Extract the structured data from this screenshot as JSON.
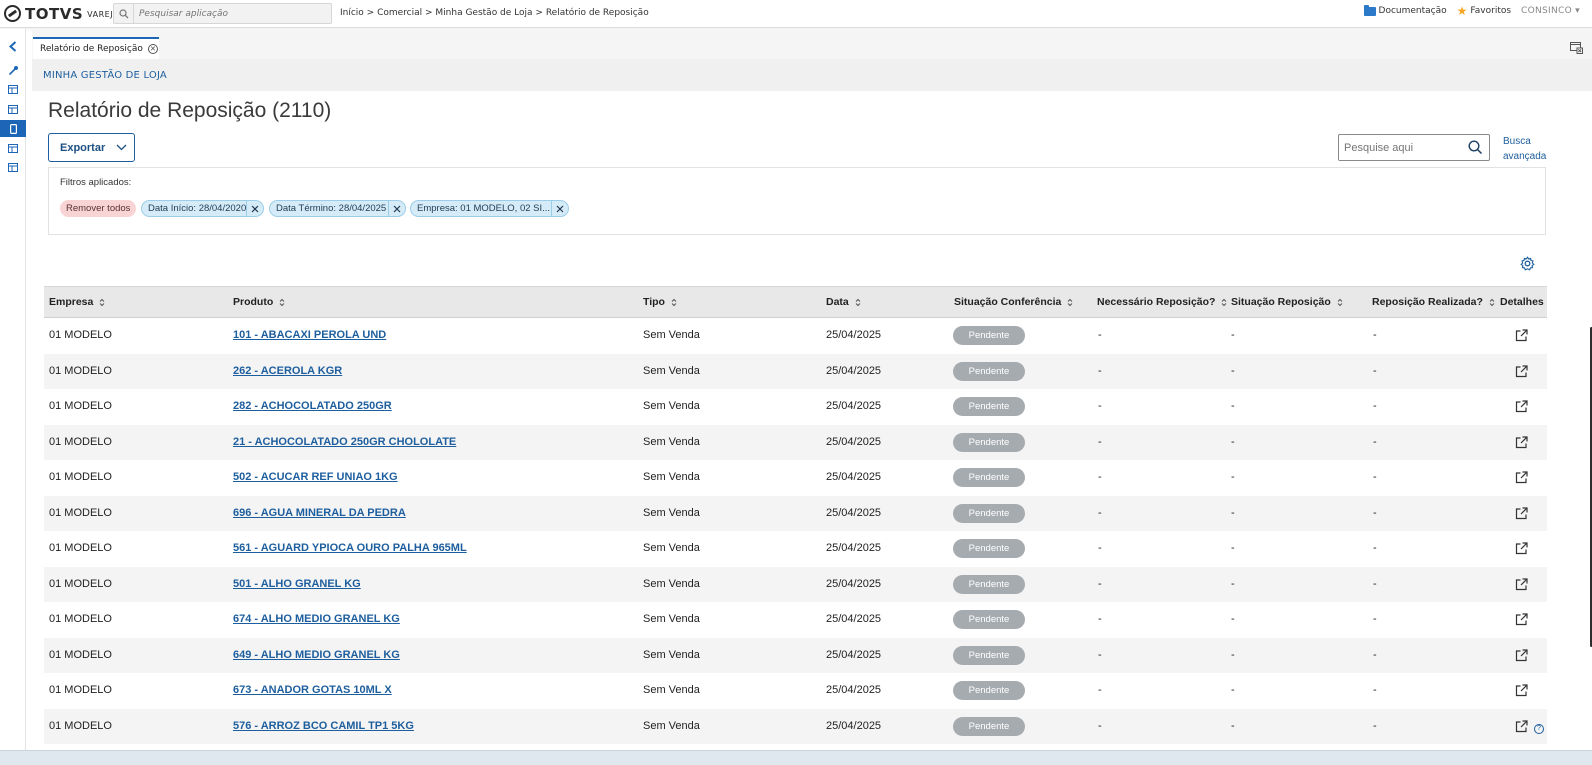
{
  "topbar": {
    "brand": "TOTVS",
    "brand_sub": "VAREJO",
    "search_placeholder": "Pesquisar aplicação",
    "breadcrumb": "Início > Comercial > Minha Gestão de Loja > Relatório de Reposição",
    "documentation_label": "Documentação",
    "favorites_label": "Favoritos",
    "user_label": "CONSINCO ▾"
  },
  "tab": {
    "label": "Relatório de Reposição"
  },
  "module": {
    "label": "MINHA GESTÃO DE LOJA"
  },
  "page": {
    "title": "Relatório de Reposição (2110)",
    "export_label": "Exportar",
    "search_placeholder": "Pesquise aqui",
    "advanced_search_line1": "Busca",
    "advanced_search_line2": "avançada"
  },
  "filters": {
    "label": "Filtros aplicados:",
    "remove_all": "Remover todos",
    "chips": [
      "Data Início: 28/04/2020",
      "Data Término: 28/04/2025",
      "Empresa: 01 MODELO, 02 SI..."
    ]
  },
  "table": {
    "columns": [
      "Empresa",
      "Produto",
      "Tipo",
      "Data",
      "Situação Conferência",
      "Necessário Reposição?",
      "Situação Reposição",
      "Reposição Realizada?",
      "Detalhes"
    ],
    "rows": [
      {
        "empresa": "01 MODELO",
        "produto": "101 - ABACAXI PEROLA UND",
        "tipo": "Sem Venda",
        "data": "25/04/2025",
        "situacao": "Pendente",
        "necessario": "-",
        "sit_repo": "-",
        "realizada": "-"
      },
      {
        "empresa": "01 MODELO",
        "produto": "262 - ACEROLA KGR",
        "tipo": "Sem Venda",
        "data": "25/04/2025",
        "situacao": "Pendente",
        "necessario": "-",
        "sit_repo": "-",
        "realizada": "-"
      },
      {
        "empresa": "01 MODELO",
        "produto": "282 - ACHOCOLATADO 250GR",
        "tipo": "Sem Venda",
        "data": "25/04/2025",
        "situacao": "Pendente",
        "necessario": "-",
        "sit_repo": "-",
        "realizada": "-"
      },
      {
        "empresa": "01 MODELO",
        "produto": "21 - ACHOCOLATADO 250GR CHOLOLATE",
        "tipo": "Sem Venda",
        "data": "25/04/2025",
        "situacao": "Pendente",
        "necessario": "-",
        "sit_repo": "-",
        "realizada": "-"
      },
      {
        "empresa": "01 MODELO",
        "produto": "502 - ACUCAR REF UNIAO 1KG",
        "tipo": "Sem Venda",
        "data": "25/04/2025",
        "situacao": "Pendente",
        "necessario": "-",
        "sit_repo": "-",
        "realizada": "-"
      },
      {
        "empresa": "01 MODELO",
        "produto": "696 - AGUA MINERAL DA PEDRA",
        "tipo": "Sem Venda",
        "data": "25/04/2025",
        "situacao": "Pendente",
        "necessario": "-",
        "sit_repo": "-",
        "realizada": "-"
      },
      {
        "empresa": "01 MODELO",
        "produto": "561 - AGUARD YPIOCA OURO PALHA 965ML",
        "tipo": "Sem Venda",
        "data": "25/04/2025",
        "situacao": "Pendente",
        "necessario": "-",
        "sit_repo": "-",
        "realizada": "-"
      },
      {
        "empresa": "01 MODELO",
        "produto": "501 - ALHO GRANEL KG",
        "tipo": "Sem Venda",
        "data": "25/04/2025",
        "situacao": "Pendente",
        "necessario": "-",
        "sit_repo": "-",
        "realizada": "-"
      },
      {
        "empresa": "01 MODELO",
        "produto": "674 - ALHO MEDIO GRANEL KG",
        "tipo": "Sem Venda",
        "data": "25/04/2025",
        "situacao": "Pendente",
        "necessario": "-",
        "sit_repo": "-",
        "realizada": "-"
      },
      {
        "empresa": "01 MODELO",
        "produto": "649 - ALHO MEDIO GRANEL KG",
        "tipo": "Sem Venda",
        "data": "25/04/2025",
        "situacao": "Pendente",
        "necessario": "-",
        "sit_repo": "-",
        "realizada": "-"
      },
      {
        "empresa": "01 MODELO",
        "produto": "673 - ANADOR GOTAS 10ML X",
        "tipo": "Sem Venda",
        "data": "25/04/2025",
        "situacao": "Pendente",
        "necessario": "-",
        "sit_repo": "-",
        "realizada": "-"
      },
      {
        "empresa": "01 MODELO",
        "produto": "576 - ARROZ BCO CAMIL TP1 5KG",
        "tipo": "Sem Venda",
        "data": "25/04/2025",
        "situacao": "Pendente",
        "necessario": "-",
        "sit_repo": "-",
        "realizada": "-"
      }
    ]
  },
  "icons": {
    "rail": [
      "chevron-left-icon",
      "wrench-icon",
      "table-icon",
      "table-icon",
      "mobile-icon",
      "table-icon",
      "table-icon"
    ],
    "detail": "external-link-icon",
    "settings": "gear-icon",
    "help": "help-icon"
  },
  "colors": {
    "accent": "#1d66b7",
    "link": "#1d5e9e",
    "badge_pending": "#a6abb0",
    "remove_chip": "#f9d4d4",
    "filter_chip": "#d5ecf8"
  }
}
